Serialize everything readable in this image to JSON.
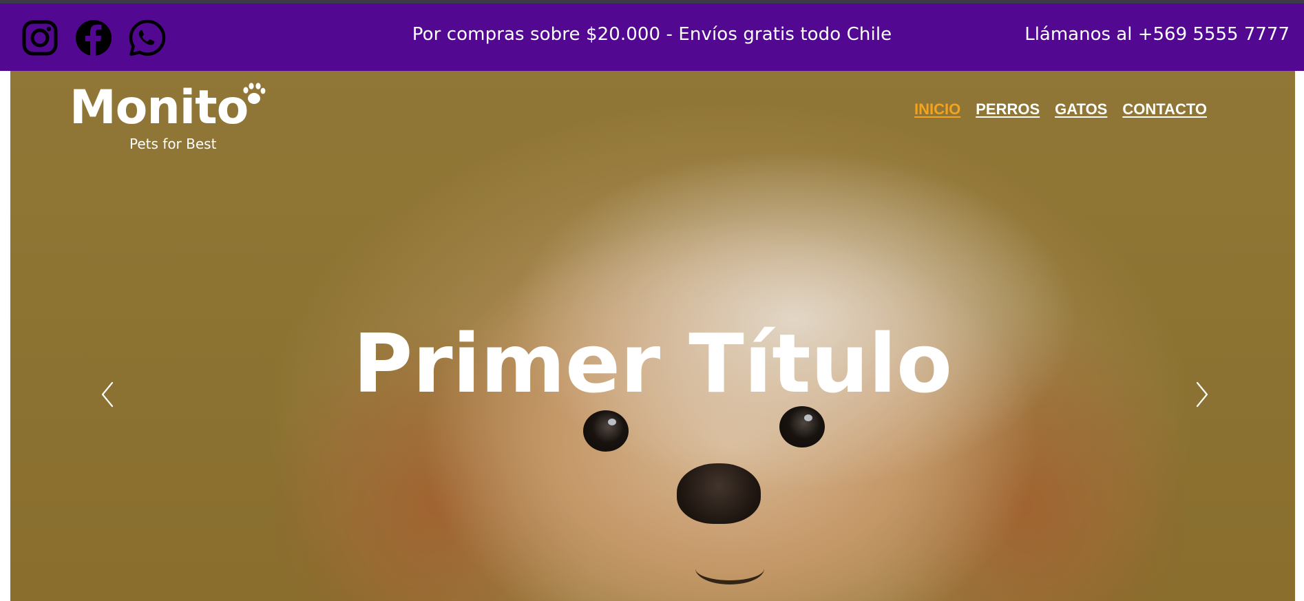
{
  "topbar": {
    "background_color": "#520891",
    "social": [
      {
        "name": "instagram",
        "icon": "instagram-icon"
      },
      {
        "name": "facebook",
        "icon": "facebook-icon"
      },
      {
        "name": "whatsapp",
        "icon": "whatsapp-icon"
      }
    ],
    "promo_text": "Por compras sobre $20.000 - Envíos gratis todo Chile",
    "phone_text": "Llámanos al +569 5555 7777"
  },
  "logo": {
    "wordmark": "Monito",
    "tagline": "Pets for Best",
    "icon": "paw-icon"
  },
  "nav": {
    "items": [
      {
        "label": "INICIO",
        "active": true
      },
      {
        "label": "PERROS",
        "active": false
      },
      {
        "label": "GATOS",
        "active": false
      },
      {
        "label": "CONTACTO",
        "active": false
      }
    ],
    "active_color": "#f5a21d"
  },
  "hero": {
    "title": "Primer Título",
    "prev_icon": "chevron-left-icon",
    "next_icon": "chevron-right-icon",
    "background_color": "#9a7c35"
  }
}
